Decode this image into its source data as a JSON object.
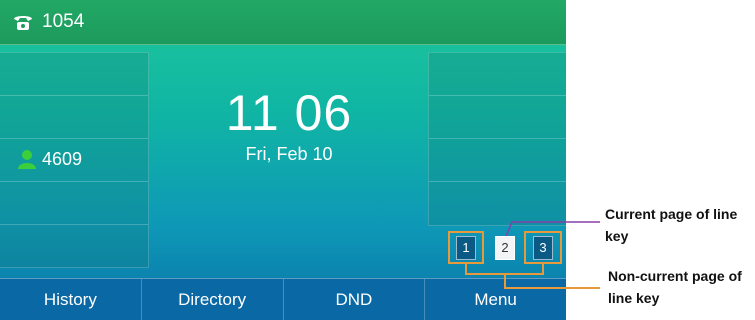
{
  "status_bar": {
    "account_number": "1054",
    "icon": "phone-icon"
  },
  "line_keys_left": [
    {
      "label": "4609",
      "icon": "person-icon"
    }
  ],
  "clock": {
    "time": "11 06",
    "date": "Fri, Feb 10"
  },
  "line_key_pages": [
    {
      "number": "1",
      "current": false
    },
    {
      "number": "2",
      "current": true
    },
    {
      "number": "3",
      "current": false
    }
  ],
  "softkeys": [
    "History",
    "Directory",
    "DND",
    "Menu"
  ],
  "annotations": {
    "current_page": "Current page of line key",
    "non_current_page": "Non-current page of line key"
  },
  "colors": {
    "highlight_orange": "#e79a3c",
    "callout_purple": "#8a3fa8",
    "topbar_green": "#22a865",
    "softkey_blue": "#0a68a4"
  }
}
